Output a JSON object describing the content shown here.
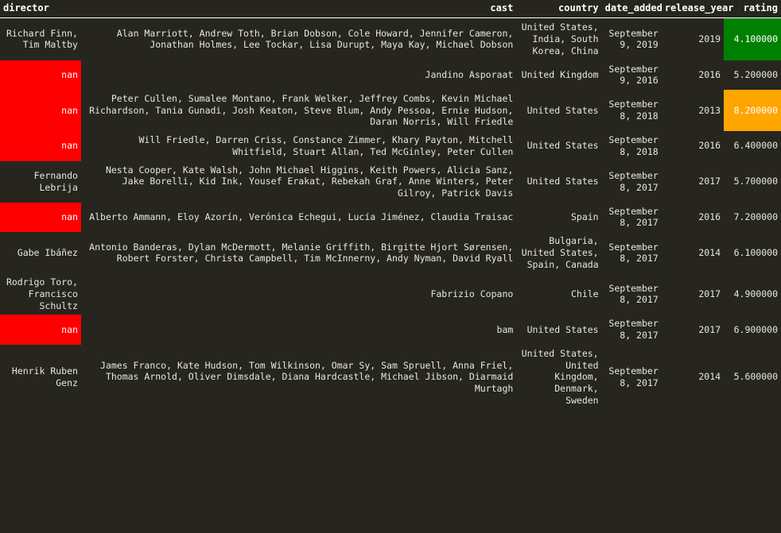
{
  "table": {
    "columns": [
      {
        "key": "director",
        "label": "director",
        "align": "left"
      },
      {
        "key": "cast",
        "label": "cast",
        "align": "right"
      },
      {
        "key": "country",
        "label": "country",
        "align": "right"
      },
      {
        "key": "date_added",
        "label": "date_added",
        "align": "right"
      },
      {
        "key": "release_year",
        "label": "release_year",
        "align": "right"
      },
      {
        "key": "rating",
        "label": "rating",
        "align": "right"
      }
    ],
    "highlight_colors": {
      "nan_missing": "#ff0000",
      "min_rating": "#008000",
      "max_rating": "#ffa500",
      "background": "#26261f",
      "text": "#e8e6e3",
      "header_text": "#ffffff",
      "header_rule": "#ffffff"
    },
    "rows": [
      {
        "director": "Richard Finn, Tim Maltby",
        "director_highlight": "none",
        "cast": "Alan Marriott, Andrew Toth, Brian Dobson, Cole Howard, Jennifer Cameron, Jonathan Holmes, Lee Tockar, Lisa Durupt, Maya Kay, Michael Dobson",
        "country": "United States, India, South Korea, China",
        "date_added": "September 9, 2019",
        "release_year": "2019",
        "rating": "4.100000",
        "rating_highlight": "green"
      },
      {
        "director": "nan",
        "director_highlight": "red",
        "cast": "Jandino Asporaat",
        "country": "United Kingdom",
        "date_added": "September 9, 2016",
        "release_year": "2016",
        "rating": "5.200000",
        "rating_highlight": "none"
      },
      {
        "director": "nan",
        "director_highlight": "red",
        "cast": "Peter Cullen, Sumalee Montano, Frank Welker, Jeffrey Combs, Kevin Michael Richardson, Tania Gunadi, Josh Keaton, Steve Blum, Andy Pessoa, Ernie Hudson, Daran Norris, Will Friedle",
        "country": "United States",
        "date_added": "September 8, 2018",
        "release_year": "2013",
        "rating": "8.200000",
        "rating_highlight": "orange"
      },
      {
        "director": "nan",
        "director_highlight": "red",
        "cast": "Will Friedle, Darren Criss, Constance Zimmer, Khary Payton, Mitchell Whitfield, Stuart Allan, Ted McGinley, Peter Cullen",
        "country": "United States",
        "date_added": "September 8, 2018",
        "release_year": "2016",
        "rating": "6.400000",
        "rating_highlight": "none"
      },
      {
        "director": "Fernando Lebrija",
        "director_highlight": "none",
        "cast": "Nesta Cooper, Kate Walsh, John Michael Higgins, Keith Powers, Alicia Sanz, Jake Borelli, Kid Ink, Yousef Erakat, Rebekah Graf, Anne Winters, Peter Gilroy, Patrick Davis",
        "country": "United States",
        "date_added": "September 8, 2017",
        "release_year": "2017",
        "rating": "5.700000",
        "rating_highlight": "none"
      },
      {
        "director": "nan",
        "director_highlight": "red",
        "cast": "Alberto Ammann, Eloy Azorín, Verónica Echegui, Lucía Jiménez, Claudia Traisac",
        "country": "Spain",
        "date_added": "September 8, 2017",
        "release_year": "2016",
        "rating": "7.200000",
        "rating_highlight": "none"
      },
      {
        "director": "Gabe Ibáñez",
        "director_highlight": "none",
        "cast": "Antonio Banderas, Dylan McDermott, Melanie Griffith, Birgitte Hjort Sørensen, Robert Forster, Christa Campbell, Tim McInnerny, Andy Nyman, David Ryall",
        "country": "Bulgaria, United States, Spain, Canada",
        "date_added": "September 8, 2017",
        "release_year": "2014",
        "rating": "6.100000",
        "rating_highlight": "none"
      },
      {
        "director": "Rodrigo Toro, Francisco Schultz",
        "director_highlight": "none",
        "cast": "Fabrizio Copano",
        "country": "Chile",
        "date_added": "September 8, 2017",
        "release_year": "2017",
        "rating": "4.900000",
        "rating_highlight": "none"
      },
      {
        "director": "nan",
        "director_highlight": "red",
        "cast": "bam",
        "country": "United States",
        "date_added": "September 8, 2017",
        "release_year": "2017",
        "rating": "6.900000",
        "rating_highlight": "none"
      },
      {
        "director": "Henrik Ruben Genz",
        "director_highlight": "none",
        "cast": "James Franco, Kate Hudson, Tom Wilkinson, Omar Sy, Sam Spruell, Anna Friel, Thomas Arnold, Oliver Dimsdale, Diana Hardcastle, Michael Jibson, Diarmaid Murtagh",
        "country": "United States, United Kingdom, Denmark, Sweden",
        "date_added": "September 8, 2017",
        "release_year": "2014",
        "rating": "5.600000",
        "rating_highlight": "none"
      }
    ]
  }
}
